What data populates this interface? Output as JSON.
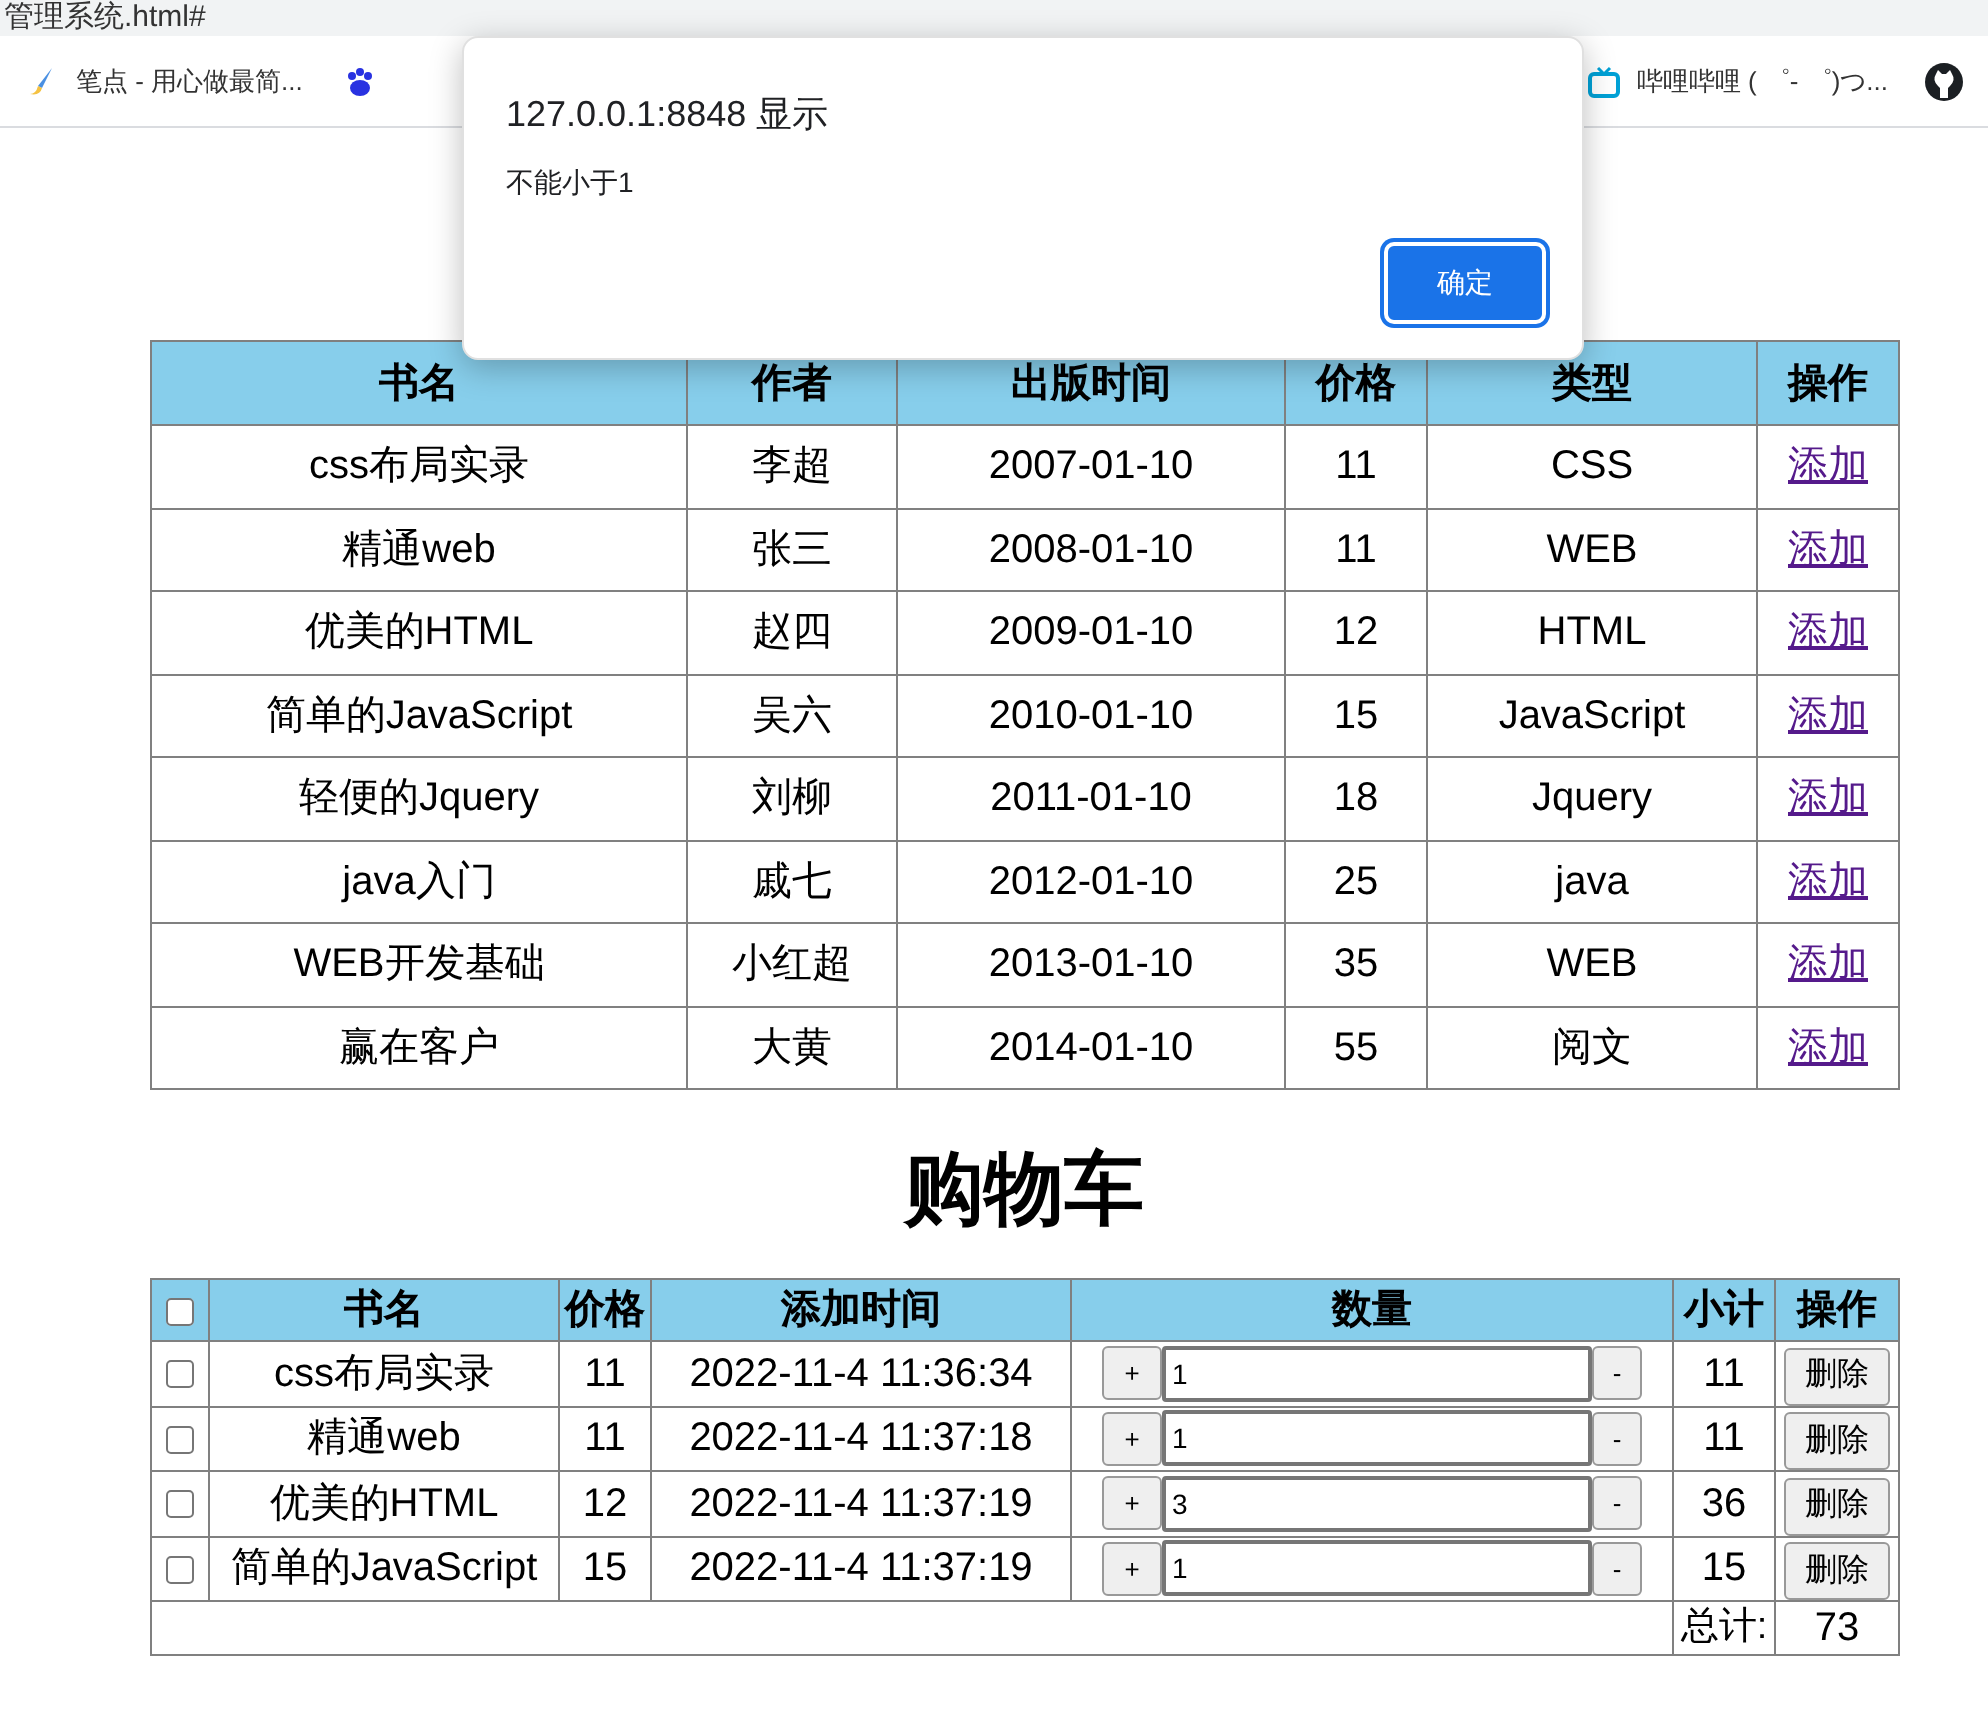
{
  "browser": {
    "tab_title": "管理系统.html#",
    "bookmarks": [
      {
        "kind": "brush",
        "label": "笔点 - 用心做最简..."
      },
      {
        "kind": "paw"
      },
      {
        "kind": "tv",
        "label": "哔哩哔哩 ( ゜- ゜)つ..."
      },
      {
        "kind": "github"
      }
    ]
  },
  "dialog": {
    "title": "127.0.0.1:8848 显示",
    "message": "不能小于1",
    "ok_button": "确定"
  },
  "books": {
    "columns": [
      "书名",
      "作者",
      "出版时间",
      "价格",
      "类型",
      "操作"
    ],
    "rows": [
      {
        "name": "css布局实录",
        "author": "李超",
        "date": "2007-01-10",
        "price": "11",
        "type": "CSS",
        "action": "添加"
      },
      {
        "name": "精通web",
        "author": "张三",
        "date": "2008-01-10",
        "price": "11",
        "type": "WEB",
        "action": "添加"
      },
      {
        "name": "优美的HTML",
        "author": "赵四",
        "date": "2009-01-10",
        "price": "12",
        "type": "HTML",
        "action": "添加"
      },
      {
        "name": "简单的JavaScript",
        "author": "吴六",
        "date": "2010-01-10",
        "price": "15",
        "type": "JavaScript",
        "action": "添加"
      },
      {
        "name": "轻便的Jquery",
        "author": "刘柳",
        "date": "2011-01-10",
        "price": "18",
        "type": "Jquery",
        "action": "添加"
      },
      {
        "name": "java入门",
        "author": "戚七",
        "date": "2012-01-10",
        "price": "25",
        "type": "java",
        "action": "添加"
      },
      {
        "name": "WEB开发基础",
        "author": "小红超",
        "date": "2013-01-10",
        "price": "35",
        "type": "WEB",
        "action": "添加"
      },
      {
        "name": "赢在客户",
        "author": "大黄",
        "date": "2014-01-10",
        "price": "55",
        "type": "阅文",
        "action": "添加"
      }
    ]
  },
  "cart": {
    "title": "购物车",
    "select_all_checked": false,
    "columns": [
      "书名",
      "价格",
      "添加时间",
      "数量",
      "小计",
      "操作"
    ],
    "rows": [
      {
        "checked": false,
        "name": "css布局实录",
        "price": "11",
        "time": "2022-11-4 11:36:34",
        "plus": "+",
        "quantity": "1",
        "minus": "-",
        "subtotal": "11",
        "delete": "删除"
      },
      {
        "checked": false,
        "name": "精通web",
        "price": "11",
        "time": "2022-11-4 11:37:18",
        "plus": "+",
        "quantity": "1",
        "minus": "-",
        "subtotal": "11",
        "delete": "删除"
      },
      {
        "checked": false,
        "name": "优美的HTML",
        "price": "12",
        "time": "2022-11-4 11:37:19",
        "plus": "+",
        "quantity": "3",
        "minus": "-",
        "subtotal": "36",
        "delete": "删除"
      },
      {
        "checked": false,
        "name": "简单的JavaScript",
        "price": "15",
        "time": "2022-11-4 11:37:19",
        "plus": "+",
        "quantity": "1",
        "minus": "-",
        "subtotal": "15",
        "delete": "删除"
      }
    ],
    "total_label": "总计:",
    "total": "73"
  }
}
